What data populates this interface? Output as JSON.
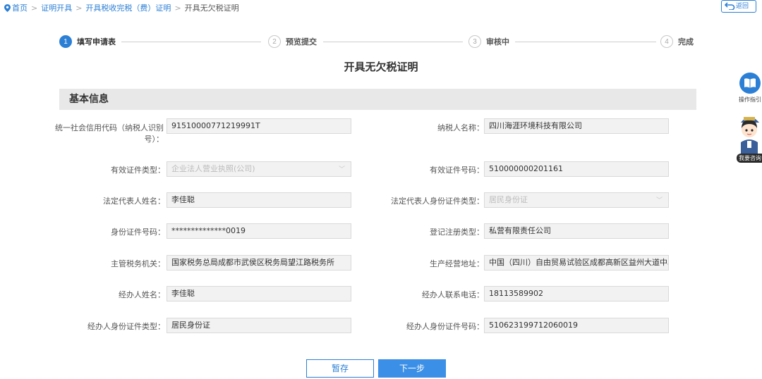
{
  "breadcrumb": {
    "home": "首页",
    "item1": "证明开具",
    "item2": "开具税收完税（费）证明",
    "current": "开具无欠税证明"
  },
  "back_button": "返回",
  "steps": [
    {
      "num": "1",
      "label": "填写申请表"
    },
    {
      "num": "2",
      "label": "预览提交"
    },
    {
      "num": "3",
      "label": "审核中"
    },
    {
      "num": "4",
      "label": "完成"
    }
  ],
  "page_title": "开具无欠税证明",
  "section_title": "基本信息",
  "fields": {
    "credit_code": {
      "label_line1": "统一社会信用代码（纳税人识别",
      "label_line2": "号）：",
      "value": "91510000771219991T"
    },
    "taxpayer_name": {
      "label": "纳税人名称：",
      "value": "四川海涯环境科技有限公司"
    },
    "cert_type": {
      "label": "有效证件类型：",
      "value": "企业法人营业执照(公司)"
    },
    "cert_no": {
      "label": "有效证件号码：",
      "value": "510000000201161"
    },
    "legal_rep_name": {
      "label": "法定代表人姓名：",
      "value": "李佳聪"
    },
    "legal_rep_id_type": {
      "label": "法定代表人身份证件类型：",
      "value": "居民身份证"
    },
    "id_no": {
      "label": "身份证件号码：",
      "value": "**************0019"
    },
    "reg_type": {
      "label": "登记注册类型：",
      "value": "私营有限责任公司"
    },
    "tax_authority": {
      "label": "主管税务机关：",
      "value": "国家税务总局成都市武侯区税务局望江路税务所"
    },
    "address": {
      "label": "生产经营地址：",
      "value": "中国（四川）自由贸易试验区成都高新区益州大道中段"
    },
    "handler_name": {
      "label": "经办人姓名：",
      "value": "李佳聪"
    },
    "handler_phone": {
      "label": "经办人联系电话：",
      "value": "18113589902"
    },
    "handler_id_type": {
      "label": "经办人身份证件类型：",
      "value": "居民身份证"
    },
    "handler_id_no": {
      "label": "经办人身份证件号码：",
      "value": "510623199712060019"
    }
  },
  "buttons": {
    "save": "暂存",
    "next": "下一步"
  },
  "side": {
    "guide": "操作指引",
    "ask": "我要咨询"
  },
  "colors": {
    "accent": "#2b7fd5",
    "primary_button": "#3b8fe6"
  }
}
